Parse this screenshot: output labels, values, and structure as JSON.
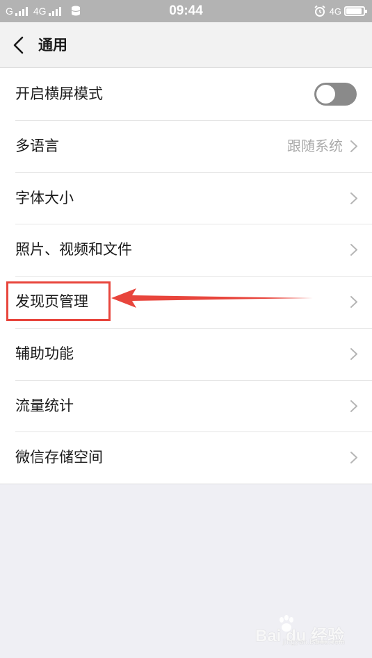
{
  "status_bar": {
    "carrier1": "G",
    "carrier2": "4G",
    "time": "09:44",
    "right_network": "4G",
    "battery_level": 0.9
  },
  "nav": {
    "title": "通用",
    "back_icon": "chevron-left-icon"
  },
  "settings": {
    "items": [
      {
        "label": "开启横屏模式",
        "control": "toggle",
        "toggle_on": false
      },
      {
        "label": "多语言",
        "value": "跟随系统",
        "control": "chevron"
      },
      {
        "label": "字体大小",
        "control": "chevron"
      },
      {
        "label": "照片、视频和文件",
        "control": "chevron"
      },
      {
        "label": "发现页管理",
        "control": "chevron",
        "highlighted": true
      },
      {
        "label": "辅助功能",
        "control": "chevron"
      },
      {
        "label": "流量统计",
        "control": "chevron"
      },
      {
        "label": "微信存储空间",
        "control": "chevron"
      }
    ]
  },
  "annotation": {
    "color": "#e8453c"
  },
  "watermark": {
    "text": "Bai du 经验",
    "sub": "jingyan.baidu.com"
  },
  "colors": {
    "status_bar": "#b3b3b3",
    "nav_bar": "#f2f2f2",
    "page_bg": "#efeff4",
    "toggle_off": "#8a8a8a"
  }
}
